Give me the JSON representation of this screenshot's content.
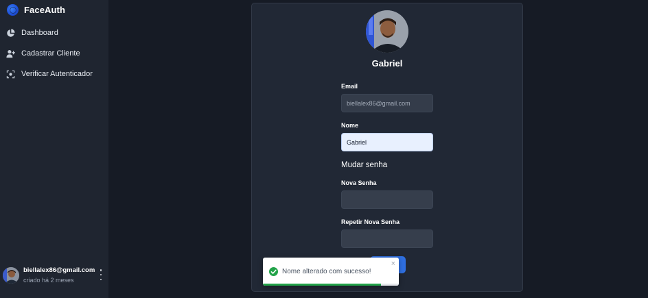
{
  "sidebar": {
    "brand": "FaceAuth",
    "items": [
      {
        "label": "Dashboard",
        "icon": "chart-pie-icon"
      },
      {
        "label": "Cadastrar Cliente",
        "icon": "user-plus-icon"
      },
      {
        "label": "Verificar Autenticador",
        "icon": "face-scan-icon"
      }
    ],
    "profile": {
      "email": "biellalex86@gmail.com",
      "meta": "criado há 2 meses"
    }
  },
  "profile_card": {
    "name": "Gabriel",
    "email_label": "Email",
    "email_value": "biellalex86@gmail.com",
    "name_label": "Nome",
    "name_value": "Gabriel",
    "password_section": "Mudar senha",
    "new_password_label": "Nova Senha",
    "repeat_password_label": "Repetir Nova Senha"
  },
  "toast": {
    "message": "Nome alterado com sucesso!",
    "close": "×",
    "progress": 0.87
  },
  "colors": {
    "accent": "#2f6fe0",
    "success": "#22a349",
    "sidebar_bg": "#1f2530",
    "page_bg": "#161b25"
  }
}
